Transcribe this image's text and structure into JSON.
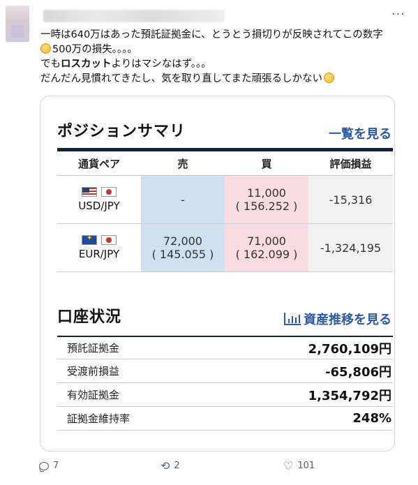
{
  "tweet": {
    "lines": [
      {
        "text": "一時は640万はあった預託証拠金に、とうとう損切りが反映されてこの数字"
      },
      {
        "emoji": "pleading-face-icon",
        "text": "500万の損失。。。。"
      },
      {
        "prefix": "でも",
        "bold": "ロスカット",
        "suffix": "よりはマシなはず。。。"
      },
      {
        "text": "だんだん見慣れてきたし、気を取り直してまた頑張るしかない",
        "emoji_after": "crying-face-icon"
      }
    ]
  },
  "positions": {
    "title": "ポジションサマリ",
    "link": "一覧を見る",
    "headers": [
      "通貨ペア",
      "売",
      "買",
      "評価損益"
    ],
    "rows": [
      {
        "flags": [
          "us-flag-icon",
          "jp-flag-icon"
        ],
        "pair": "USD/JPY",
        "sell_amount": "-",
        "sell_rate": "",
        "buy_amount": "11,000",
        "buy_rate": "( 156.252 )",
        "pl": "-15,316"
      },
      {
        "flags": [
          "eu-flag-icon",
          "jp-flag-icon"
        ],
        "pair": "EUR/JPY",
        "sell_amount": "72,000",
        "sell_rate": "( 145.055 )",
        "buy_amount": "71,000",
        "buy_rate": "( 162.099 )",
        "pl": "-1,324,195"
      }
    ]
  },
  "account": {
    "title": "口座状況",
    "link": "資産推移を見る",
    "rows": [
      {
        "label": "預託証拠金",
        "value": "2,760,109円"
      },
      {
        "label": "受渡前損益",
        "value": "-65,806円"
      },
      {
        "label": "有効証拠金",
        "value": "1,354,792円"
      },
      {
        "label": "証拠金維持率",
        "value": "248%"
      }
    ]
  },
  "actions": {
    "replies": "7",
    "retweets": "2",
    "likes": "101"
  },
  "colors": {
    "header_navy": "#15233a",
    "link_blue": "#2d5ba8",
    "sell_bg": "#cfe0ee",
    "buy_bg": "#f8dce2",
    "pl_bg": "#f1f1f1"
  }
}
